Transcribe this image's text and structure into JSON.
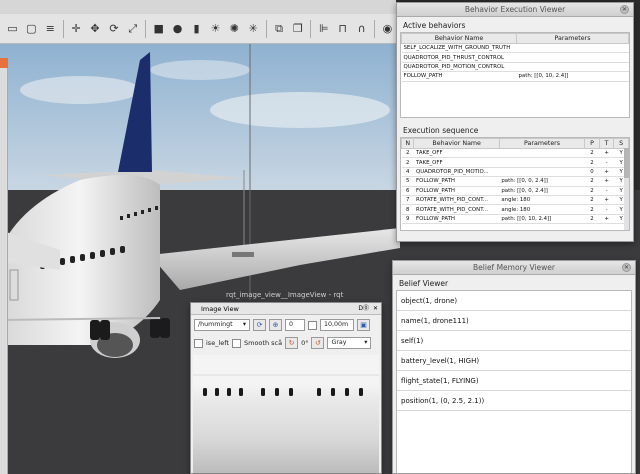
{
  "toolbar": {
    "icons": [
      "window-icon",
      "arrow-icon",
      "box-icon",
      "lines-icon",
      "move-icon",
      "rotate-icon",
      "scale-icon",
      "box2-icon",
      "sphere-icon",
      "cylinder-icon",
      "sun-icon",
      "point-light-icon",
      "spot-light-icon",
      "copy-icon",
      "paste-icon",
      "align-icon",
      "snap-icon",
      "magnet-icon",
      "screenshot-icon"
    ]
  },
  "behavior_window": {
    "title": "Behavior Execution Viewer",
    "active_label": "Active behaviors",
    "active_headers": [
      "Behavior Name",
      "Parameters"
    ],
    "active_rows": [
      [
        "SELF_LOCALIZE_WITH_GROUND_TRUTH",
        ""
      ],
      [
        "QUADROTOR_PID_THRUST_CONTROL",
        ""
      ],
      [
        "QUADROTOR_PID_MOTION_CONTROL",
        ""
      ],
      [
        "FOLLOW_PATH",
        "path: [[0, 10, 2.4]]"
      ]
    ],
    "seq_label": "Execution sequence",
    "seq_headers": [
      "N",
      "Behavior Name",
      "Parameters",
      "P",
      "T",
      "S"
    ],
    "seq_rows": [
      [
        "2",
        "TAKE_OFF",
        "",
        "2",
        "+",
        "Y"
      ],
      [
        "2",
        "TAKE_OFF",
        "",
        "2",
        "-",
        "Y"
      ],
      [
        "4",
        "QUADROTOR_PID_MOTIO...",
        "",
        "0",
        "+",
        "Y"
      ],
      [
        "5",
        "FOLLOW_PATH",
        "path: [[0, 0, 2.4]]",
        "2",
        "+",
        "Y"
      ],
      [
        "6",
        "FOLLOW_PATH",
        "path: [[0, 0, 2.4]]",
        "2",
        "-",
        "Y"
      ],
      [
        "7",
        "ROTATE_WITH_PID_CONT...",
        "angle: 180",
        "2",
        "+",
        "Y"
      ],
      [
        "8",
        "ROTATE_WITH_PID_CONT...",
        "angle: 180",
        "2",
        "-",
        "Y"
      ],
      [
        "9",
        "FOLLOW_PATH",
        "path: [[0, 10, 2.4]]",
        "2",
        "+",
        "Y"
      ]
    ]
  },
  "belief_window": {
    "title": "Belief Memory Viewer",
    "label": "Belief Viewer",
    "rows": [
      "object(1, drone)",
      "name(1, drone111)",
      "self(1)",
      "battery_level(1, HIGH)",
      "flight_state(1, FLYING)",
      "position(1, (0, 2.5, 2.1))"
    ]
  },
  "image_window": {
    "title": "rqt_image_view__ImageView - rqt",
    "header": "Image View",
    "header_right": "D⓪",
    "topic": "/hummingt",
    "num_value": "0",
    "distance_value": "10,00m",
    "check_label": "ise_left",
    "smooth_label": "Smooth scå",
    "rotation": "0°",
    "color_mode": "Gray"
  },
  "colors": {
    "sky": "#a9c4dc",
    "ground": "#3b3b3d",
    "tail": "#1c2d6b",
    "accent_orange": "#e6713c"
  }
}
